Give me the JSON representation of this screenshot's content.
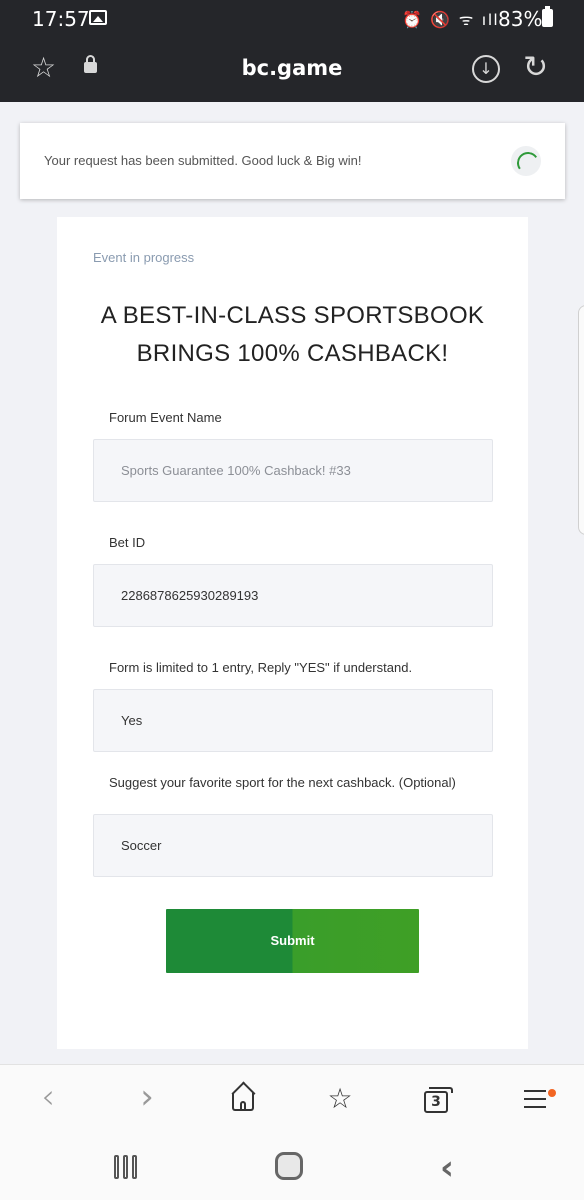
{
  "status_bar": {
    "time": "17:57",
    "system_icons": "⏰ 🔇 ᯤ ıll",
    "battery": "83%"
  },
  "browser": {
    "url": "bc.game",
    "download_glyph": "↓",
    "reload_glyph": "↻",
    "bookmark_glyph": "☆"
  },
  "toast": {
    "message": "Your request has been submitted. Good luck & Big win!"
  },
  "form": {
    "status": "Event in progress",
    "headline_line1": "A BEST-IN-CLASS SPORTSBOOK",
    "headline_line2": "BRINGS 100% CASHBACK!",
    "fields": [
      {
        "label": "Forum Event Name",
        "value": "Sports Guarantee 100% Cashback! #33"
      },
      {
        "label": "Bet ID",
        "value": "2286878625930289193"
      },
      {
        "label": "Form is limited to 1 entry, Reply \"YES\" if understand.",
        "value": "Yes"
      },
      {
        "label": "Suggest your favorite sport for the next cashback. (Optional)",
        "value": "Soccer"
      }
    ],
    "submit_label": "Submit"
  },
  "bottom_nav": {
    "back_glyph": "‹",
    "forward_glyph": "›",
    "tab_count": "3",
    "bookmarks_glyph": "☆"
  },
  "system_nav": {
    "back_glyph": "‹"
  },
  "colors": {
    "topbar": "#25262a",
    "submit": "#1e8a37",
    "spinner": "#2f9a3a",
    "notification_dot": "#f26522"
  }
}
